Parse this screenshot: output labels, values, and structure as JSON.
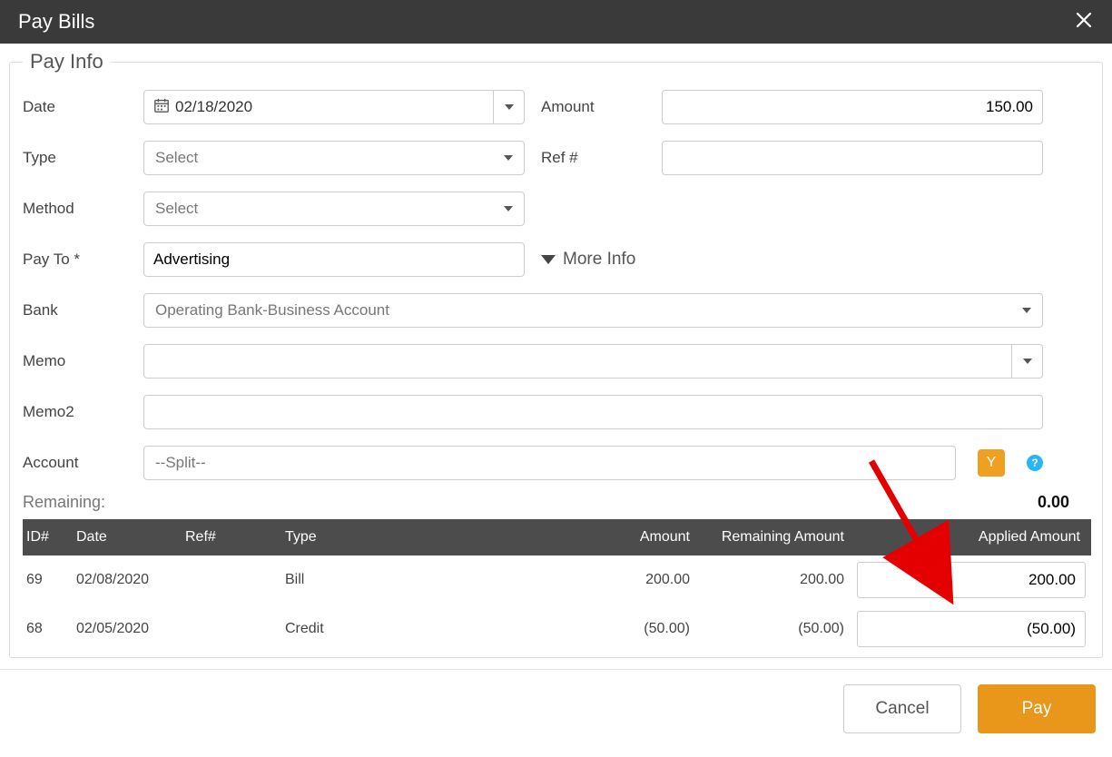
{
  "titlebar": {
    "title": "Pay Bills"
  },
  "fieldset": {
    "legend": "Pay Info"
  },
  "labels": {
    "date": "Date",
    "type": "Type",
    "method": "Method",
    "payto": "Pay To *",
    "bank": "Bank",
    "memo": "Memo",
    "memo2": "Memo2",
    "account": "Account",
    "amount": "Amount",
    "ref": "Ref #",
    "more": "More Info",
    "remaining": "Remaining:"
  },
  "values": {
    "date": "02/18/2020",
    "type": "Select",
    "method": "Select",
    "payto": "Advertising",
    "bank": "Operating Bank-Business Account",
    "memo": "",
    "memo2": "",
    "account": "--Split--",
    "amount": "150.00",
    "ref": "",
    "remaining": "0.00",
    "y": "Y",
    "help": "?"
  },
  "table": {
    "headers": {
      "id": "ID#",
      "date": "Date",
      "ref": "Ref#",
      "type": "Type",
      "amount": "Amount",
      "remaining": "Remaining Amount",
      "applied": "Applied Amount"
    },
    "rows": [
      {
        "id": "69",
        "date": "02/08/2020",
        "ref": "",
        "type": "Bill",
        "amount": "200.00",
        "remaining": "200.00",
        "applied": "200.00"
      },
      {
        "id": "68",
        "date": "02/05/2020",
        "ref": "",
        "type": "Credit",
        "amount": "(50.00)",
        "remaining": "(50.00)",
        "applied": "(50.00)"
      }
    ]
  },
  "footer": {
    "cancel": "Cancel",
    "pay": "Pay"
  }
}
